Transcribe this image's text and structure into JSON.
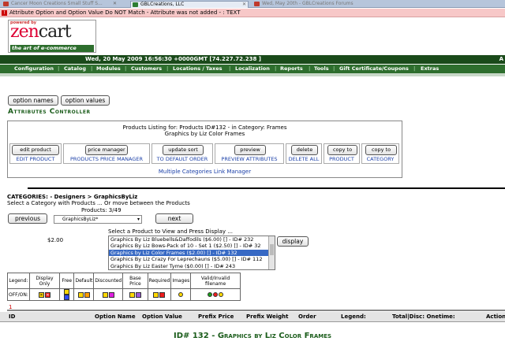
{
  "browser": {
    "tabs": [
      {
        "label": "Cancer Moon Creations Small Stuff S...",
        "color": "#c0392b"
      },
      {
        "label": "GBLCreations, LLC",
        "color": "#2e7d32"
      },
      {
        "label": "Wed, May 20th - GBLCreations Forums",
        "color": "#c0392b"
      }
    ]
  },
  "error": {
    "message": "Attribute Option and Option Value Do NOT Match - Attribute was not added - : TEXT"
  },
  "logo": {
    "powered_by": "powered by",
    "name_z": "zen",
    "name_rest": "cart",
    "tagline": "the art of e-commerce"
  },
  "header": {
    "datetime": "Wed, 20 May 2009 16:56:30 +0000GMT [74.227.72.238 ]",
    "right_letter": "A"
  },
  "nav": {
    "items": [
      "Configuration",
      "Catalog",
      "Modules",
      "Customers",
      "Locations / Taxes",
      "Localization",
      "Reports",
      "Tools",
      "Gift Certificate/Coupons",
      "Extras"
    ]
  },
  "toolbar": {
    "option_names": "option names",
    "option_values": "option values"
  },
  "page_title": "Attributes Controller",
  "listing": {
    "line1": "Products Listing for: Products ID#132 - in Category: Frames",
    "line2": "Graphics by Liz Color Frames",
    "actions": [
      {
        "button": "edit product",
        "label": "EDIT PRODUCT"
      },
      {
        "button": "price manager",
        "label": "PRODUCTS PRICE MANAGER"
      },
      {
        "button": "update sort",
        "label": "TO DEFAULT ORDER"
      },
      {
        "button": "preview",
        "label": "PREVIEW ATTRIBUTES"
      },
      {
        "button": "delete",
        "label": "DELETE ALL"
      },
      {
        "button": "copy to",
        "label": "PRODUCT"
      },
      {
        "button": "copy to",
        "label": "CATEGORY"
      }
    ],
    "multi_link": "Multiple Categories Link Manager"
  },
  "categories": {
    "path": "CATEGORIES:  - Designers > GraphicsByLiz",
    "help": "Select a Category with Products ... Or move between the Products",
    "count": "Products: 3/49",
    "previous": "previous",
    "next": "next",
    "selected_category": "GraphicsByLiz*"
  },
  "product_select": {
    "price": "$2.00",
    "prompt": "Select a Product to View and Press Display ...",
    "options": [
      "Graphics By Liz Bluebells&Daffodils ($6.00) [] - ID# 232",
      "Graphics By Liz Bows-Pack of 10 - Set 1 ($2.50) [] - ID# 32",
      "Graphics by Liz Color Frames ($2.00) [] - ID# 132",
      "Graphics By Liz Crazy For Leprechauns ($5.00) [] - ID# 112",
      "Graphics By Liz Easter Tyme ($0.00) [] - ID# 243"
    ],
    "selected_index": 2,
    "display": "display"
  },
  "legend": {
    "headers": [
      "Legend:",
      "Display Only",
      "Free",
      "Default",
      "Discounted",
      "Base Price",
      "Required",
      "Images",
      "Valid/Invalid filename"
    ],
    "row_label": "OFF/ON:",
    "colors": {
      "off": "#ffd800",
      "red": "#ee1c1c",
      "blue": "#2d4cff",
      "orange": "#ff9c00",
      "magenta": "#e020e0",
      "purple": "#9a57d6",
      "green": "#1a9e1a"
    }
  },
  "marker": "1",
  "table_headers": [
    "ID",
    "Option Name",
    "Option Value",
    "Prefix Price",
    "Prefix Weight",
    "Order",
    "Legend:",
    "Total|Disc: Onetime:",
    "Action"
  ],
  "bottom_title": "ID# 132 - Graphics by Liz Color Frames"
}
